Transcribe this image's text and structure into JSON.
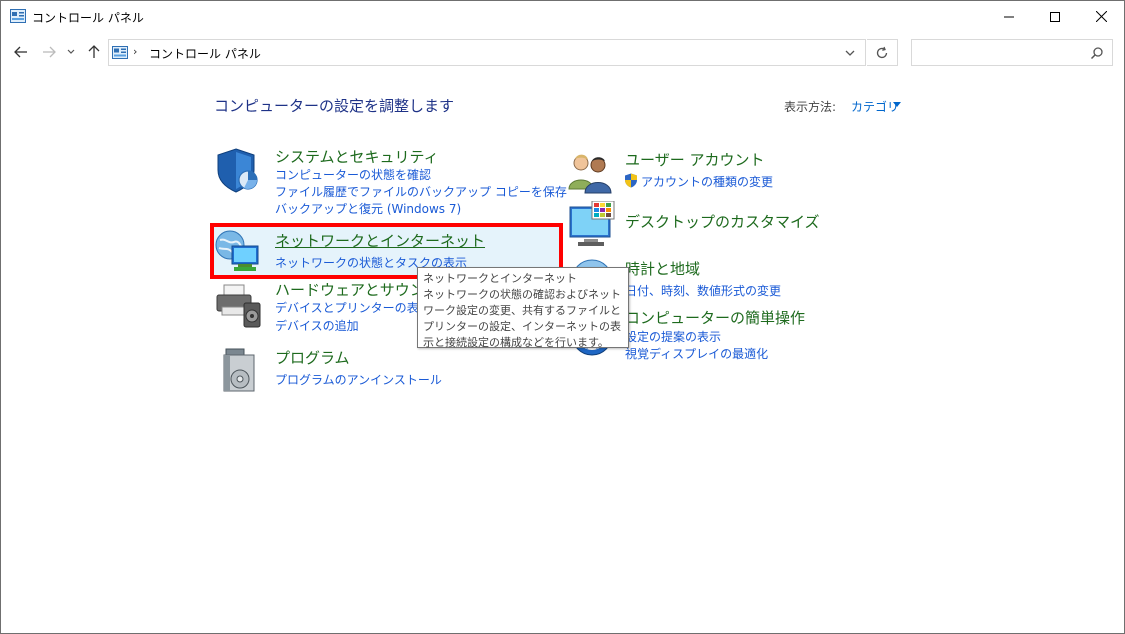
{
  "window": {
    "title": "コントロール パネル"
  },
  "address": {
    "separator": "›",
    "breadcrumb": "コントロール パネル",
    "trailing_separator": "›",
    "search_placeholder": ""
  },
  "content": {
    "heading": "コンピューターの設定を調整します",
    "view_by_label": "表示方法:",
    "view_by_value": "カテゴリ"
  },
  "categories": {
    "system": {
      "title": "システムとセキュリティ",
      "links": [
        "コンピューターの状態を確認",
        "ファイル履歴でファイルのバックアップ コピーを保存",
        "バックアップと復元 (Windows 7)"
      ]
    },
    "network": {
      "title": "ネットワークとインターネット",
      "links": [
        "ネットワークの状態とタスクの表示"
      ]
    },
    "hardware": {
      "title": "ハードウェアとサウンド",
      "links": [
        "デバイスとプリンターの表示",
        "デバイスの追加"
      ]
    },
    "programs": {
      "title": "プログラム",
      "links": [
        "プログラムのアンインストール"
      ]
    },
    "user_accounts": {
      "title": "ユーザー アカウント",
      "links": [
        "アカウントの種類の変更"
      ]
    },
    "appearance": {
      "title": "デスクトップのカスタマイズ",
      "links": []
    },
    "clock": {
      "title": "時計と地域",
      "links": [
        "日付、時刻、数値形式の変更"
      ]
    },
    "ease": {
      "title": "コンピューターの簡単操作",
      "links": [
        "設定の提案の表示",
        "視覚ディスプレイの最適化"
      ]
    }
  },
  "tooltip": {
    "title": "ネットワークとインターネット",
    "description": "ネットワークの状態の確認およびネットワーク設定の変更、共有するファイルとプリンターの設定、インターネットの表示と接続設定の構成などを行います。"
  },
  "colors": {
    "accent_link": "#1a5ad6",
    "category_title": "#1d6a1d",
    "heading": "#1e3287",
    "highlight_box": "#ff0000",
    "hover_background": "#e5f3fb"
  },
  "icons": {
    "app": "control-panel-icon",
    "minimize": "minimize-icon",
    "maximize": "maximize-icon",
    "close": "close-icon",
    "back": "arrow-left-icon",
    "forward": "arrow-right-icon",
    "recent": "chevron-down-icon",
    "up": "arrow-up-icon",
    "refresh": "refresh-icon",
    "search": "search-icon"
  }
}
